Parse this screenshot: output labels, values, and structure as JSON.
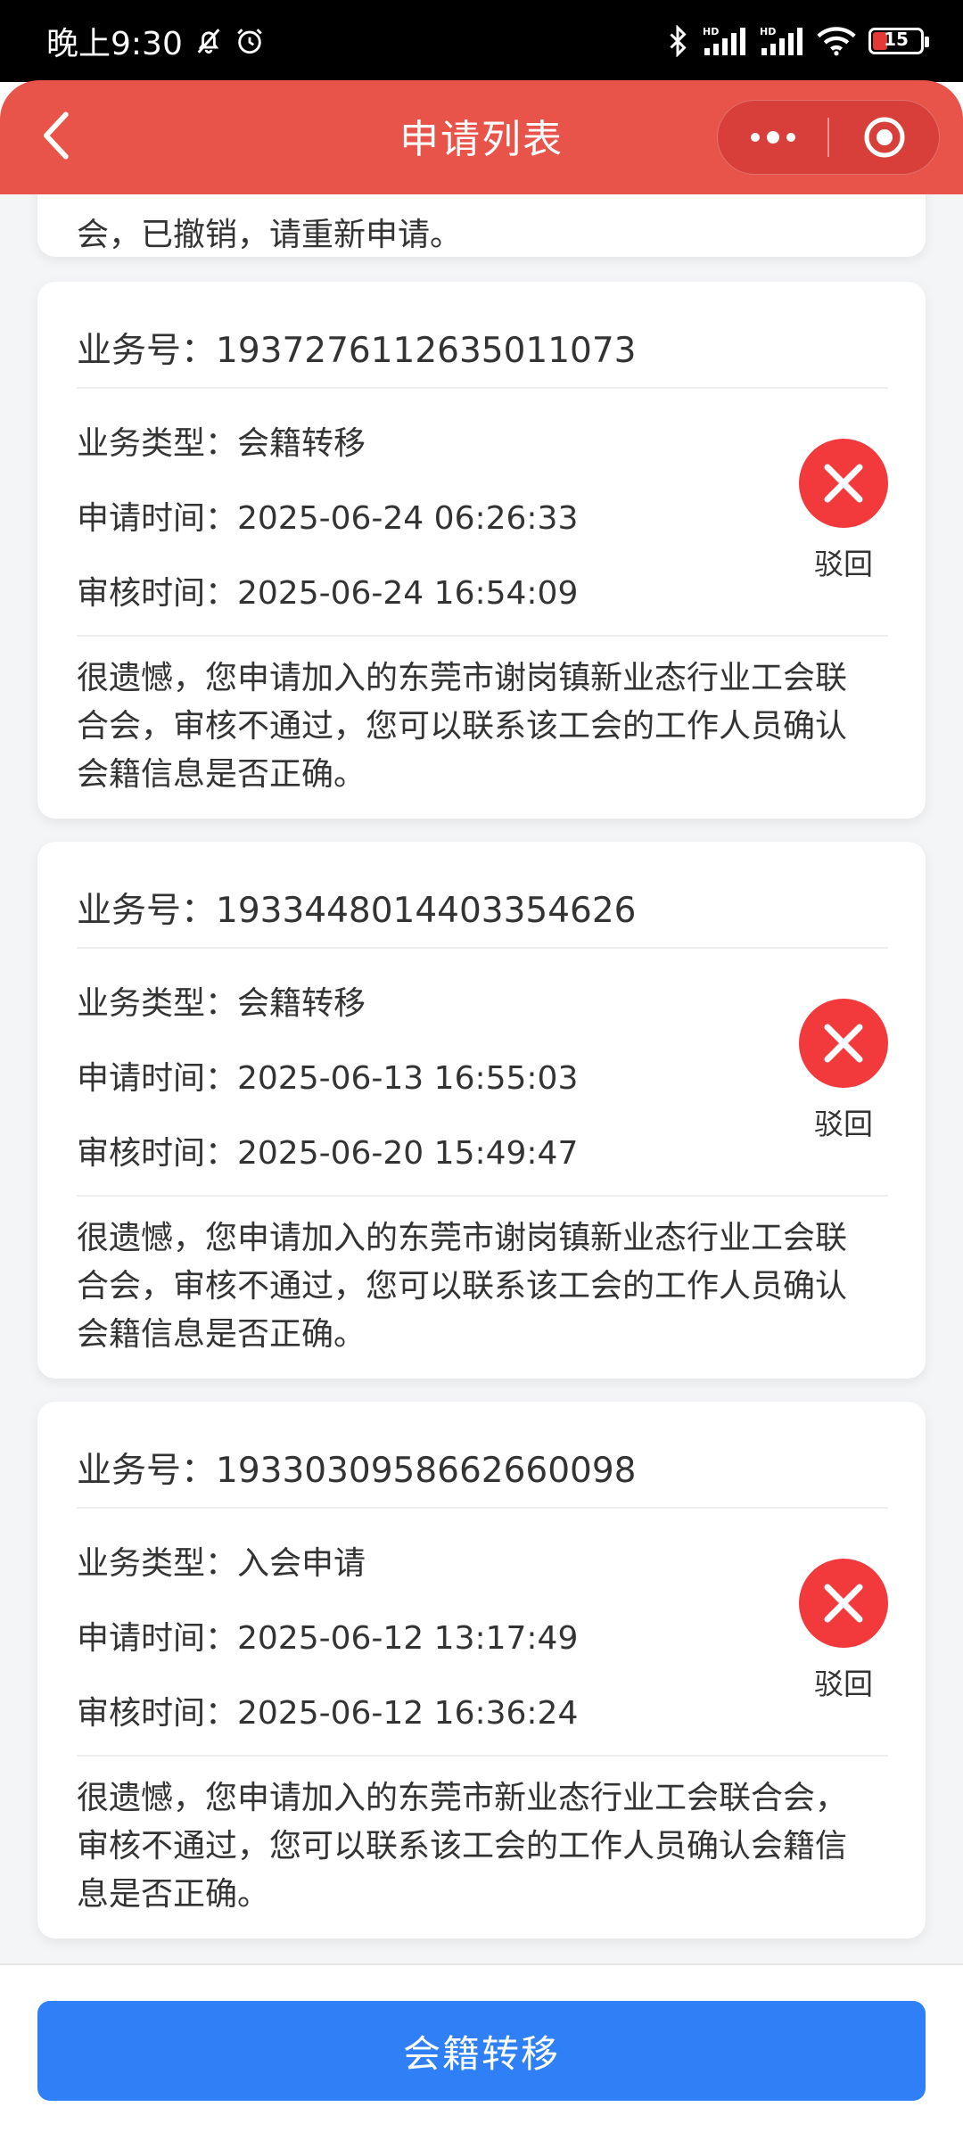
{
  "status_bar": {
    "time": "晚上9:30",
    "icons": [
      "mute-bell-icon",
      "alarm-icon",
      "bluetooth-icon",
      "hd-signal-icon",
      "hd-signal-icon",
      "wifi-icon",
      "battery-icon"
    ],
    "hd_label": "HD",
    "battery": "15",
    "battery_color": "#e53935"
  },
  "header": {
    "title": "申请列表",
    "bg_color": "#e8534a"
  },
  "partial_card": {
    "text": "会，已撤销，请重新申请。"
  },
  "cards": [
    {
      "biz_no": "业务号：1937276112635011073",
      "type": "业务类型：会籍转移",
      "apply_time": "申请时间：2025-06-24 06:26:33",
      "review_time": "审核时间：2025-06-24 16:54:09",
      "status": "驳回",
      "message": "很遗憾，您申请加入的东莞市谢岗镇新业态行业工会联合会，审核不通过，您可以联系该工会的工作人员确认会籍信息是否正确。"
    },
    {
      "biz_no": "业务号：1933448014403354626",
      "type": "业务类型：会籍转移",
      "apply_time": "申请时间：2025-06-13 16:55:03",
      "review_time": "审核时间：2025-06-20 15:49:47",
      "status": "驳回",
      "message": "很遗憾，您申请加入的东莞市谢岗镇新业态行业工会联合会，审核不通过，您可以联系该工会的工作人员确认会籍信息是否正确。"
    },
    {
      "biz_no": "业务号：1933030958662660098",
      "type": "业务类型：入会申请",
      "apply_time": "申请时间：2025-06-12 13:17:49",
      "review_time": "审核时间：2025-06-12 16:36:24",
      "status": "驳回",
      "message": "很遗憾，您申请加入的东莞市新业态行业工会联合会，审核不通过，您可以联系该工会的工作人员确认会籍信息是否正确。"
    }
  ],
  "status_color": "#f23a3c",
  "footer": {
    "button_label": "会籍转移",
    "button_color": "#2f80f6"
  }
}
